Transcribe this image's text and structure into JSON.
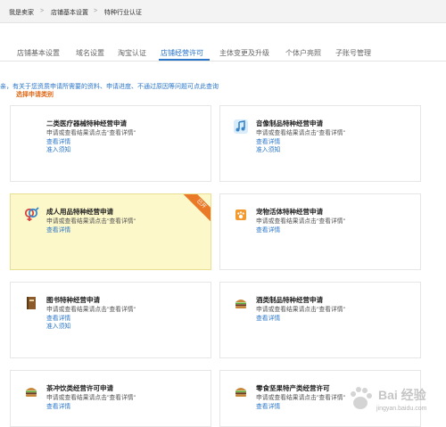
{
  "breadcrumb": {
    "items": [
      "我是卖家",
      "店铺基本设置",
      "特种行业认证"
    ],
    "separator": ">"
  },
  "tabs": [
    {
      "label": "店铺基本设置",
      "active": false
    },
    {
      "label": "域名设置",
      "active": false
    },
    {
      "label": "淘宝认证",
      "active": false
    },
    {
      "label": "店铺经营许可",
      "active": true
    },
    {
      "label": "主体变更及升级",
      "active": false
    },
    {
      "label": "个体户亮照",
      "active": false
    },
    {
      "label": "子账号管理",
      "active": false
    }
  ],
  "notice": "亲，有关于您资质申请所需要的资料、申请进度、不通过原因等问题可点此查询",
  "choose_label": "选择申请类别",
  "cards": [
    {
      "title": "二类医疗器械特种经营申请",
      "desc": "申请或查看结果请点击\"查看详情\"",
      "link1": "查看详情",
      "link2": "准入须知",
      "icon": "medical-icon"
    },
    {
      "title": "音像制品特种经营申请",
      "desc": "申请或查看结果请点击\"查看详情\"",
      "link1": "查看详情",
      "link2": "准入须知",
      "icon": "music-note-icon"
    },
    {
      "title": "成人用品特种经营申请",
      "desc": "申请或查看结果请点击\"查看详情\"",
      "link1": "查看详情",
      "link2": "",
      "icon": "gender-icon",
      "ribbon": "已开"
    },
    {
      "title": "宠物活体特种经营申请",
      "desc": "申请或查看结果请点击\"查看详情\"",
      "link1": "查看详情",
      "link2": "",
      "icon": "pet-paw-icon"
    },
    {
      "title": "图书特种经营申请",
      "desc": "申请或查看结果请点击\"查看详情\"",
      "link1": "查看详情",
      "link2": "准入须知",
      "icon": "book-icon"
    },
    {
      "title": "酒类制品特种经营申请",
      "desc": "申请或查看结果请点击\"查看详情\"",
      "link1": "查看详情",
      "link2": "",
      "icon": "burger-icon"
    },
    {
      "title": "茶冲饮类经营许可申请",
      "desc": "申请或查看结果请点击\"查看详情\"",
      "link1": "查看详情",
      "link2": "",
      "icon": "burger-icon"
    },
    {
      "title": "零食坚果特产类经营许可",
      "desc": "申请或查看结果请点击\"查看详情\"",
      "link1": "查看详情",
      "link2": "",
      "icon": "burger-icon"
    }
  ],
  "watermark": {
    "text": "Bai 经验",
    "sub": "jingyan.baidu.com"
  },
  "colors": {
    "accent": "#2b76c9",
    "highlight_bg": "#fdf8c9",
    "ribbon": "#ea7a28",
    "choose": "#e06a1a"
  }
}
